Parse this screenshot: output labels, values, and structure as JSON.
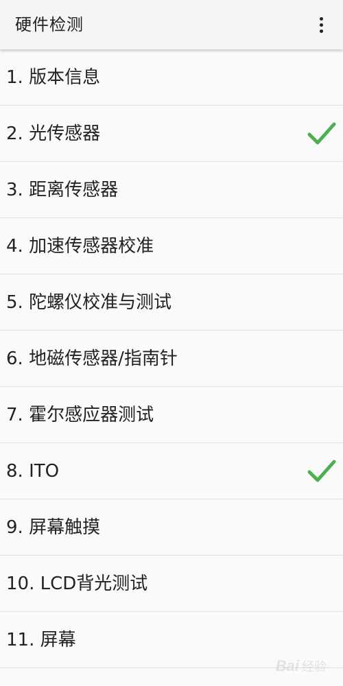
{
  "app_bar": {
    "title": "硬件检测",
    "overflow_icon": "more-vert-icon"
  },
  "items": [
    {
      "label": "1. 版本信息",
      "checked": false
    },
    {
      "label": "2. 光传感器",
      "checked": true
    },
    {
      "label": "3. 距离传感器",
      "checked": false
    },
    {
      "label": "4. 加速传感器校准",
      "checked": false
    },
    {
      "label": "5. 陀螺仪校准与测试",
      "checked": false
    },
    {
      "label": "6. 地磁传感器/指南针",
      "checked": false
    },
    {
      "label": "7. 霍尔感应器测试",
      "checked": false
    },
    {
      "label": "8. ITO",
      "checked": true
    },
    {
      "label": "9. 屏幕触摸",
      "checked": false
    },
    {
      "label": "10. LCD背光测试",
      "checked": false
    },
    {
      "label": "11. 屏幕",
      "checked": false
    }
  ],
  "colors": {
    "check": "#4caf50",
    "divider": "#dedede",
    "text": "#222222",
    "app_bar_bg": "#f5f5f5"
  },
  "watermark": {
    "text": "Bai",
    "suffix": "经验"
  }
}
